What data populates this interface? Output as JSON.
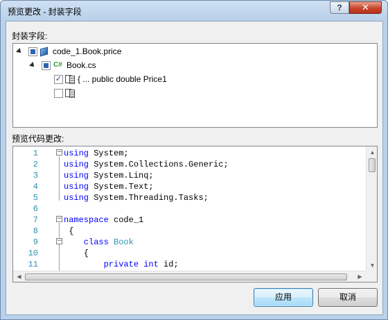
{
  "window": {
    "title": "预览更改 - 封装字段",
    "help_label": "?",
    "close_label": "✕"
  },
  "fields_section": {
    "label": "封装字段:",
    "tree": [
      {
        "text": "code_1.Book.price",
        "icon": "class-cube-icon",
        "state": "partial"
      },
      {
        "text": "Book.cs",
        "icon": "csharp-file-icon",
        "icon_text": "C#",
        "state": "partial"
      },
      {
        "text": "{ ... public double Price1",
        "icon": "property-icon",
        "state": "checked",
        "check_mark": "✓"
      },
      {
        "text": "",
        "icon": "property-icon",
        "state": "unchecked"
      }
    ]
  },
  "code_section": {
    "label": "预览代码更改:",
    "lines": [
      {
        "num": "1",
        "parts": [
          {
            "t": "using",
            "c": "kw"
          },
          {
            "t": " System;",
            "c": ""
          }
        ]
      },
      {
        "num": "2",
        "parts": [
          {
            "t": "using",
            "c": "kw"
          },
          {
            "t": " System.Collections.Generic;",
            "c": ""
          }
        ]
      },
      {
        "num": "3",
        "parts": [
          {
            "t": "using",
            "c": "kw"
          },
          {
            "t": " System.Linq;",
            "c": ""
          }
        ]
      },
      {
        "num": "4",
        "parts": [
          {
            "t": "using",
            "c": "kw"
          },
          {
            "t": " System.Text;",
            "c": ""
          }
        ]
      },
      {
        "num": "5",
        "parts": [
          {
            "t": "using",
            "c": "kw"
          },
          {
            "t": " System.Threading.Tasks;",
            "c": ""
          }
        ]
      },
      {
        "num": "6",
        "parts": []
      },
      {
        "num": "7",
        "parts": [
          {
            "t": "namespace",
            "c": "kw"
          },
          {
            "t": " code_1",
            "c": ""
          }
        ]
      },
      {
        "num": "8",
        "parts": [
          {
            "t": " {",
            "c": ""
          }
        ]
      },
      {
        "num": "9",
        "parts": [
          {
            "t": "    class",
            "c": "kw"
          },
          {
            "t": " ",
            "c": ""
          },
          {
            "t": "Book",
            "c": "ty"
          }
        ]
      },
      {
        "num": "10",
        "parts": [
          {
            "t": "    {",
            "c": ""
          }
        ]
      },
      {
        "num": "11",
        "parts": [
          {
            "t": "        private",
            "c": "kw"
          },
          {
            "t": " ",
            "c": ""
          },
          {
            "t": "int",
            "c": "kw"
          },
          {
            "t": " id;",
            "c": ""
          }
        ]
      }
    ],
    "fold_markers": [
      "−",
      "−",
      "−"
    ]
  },
  "buttons": {
    "apply": "应用",
    "cancel": "取消"
  },
  "colors": {
    "keyword": "#0000ff",
    "type": "#2b91af",
    "line_number": "#2b91af",
    "accent": "#3c7fb1"
  }
}
